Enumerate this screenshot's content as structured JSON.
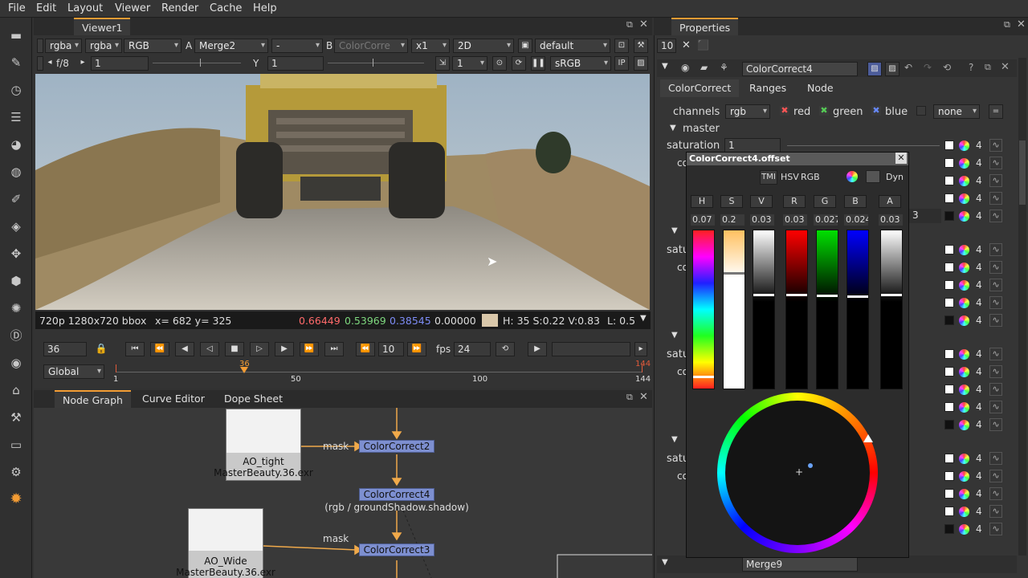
{
  "menubar": {
    "items": [
      "File",
      "Edit",
      "Layout",
      "Viewer",
      "Render",
      "Cache",
      "Help"
    ]
  },
  "viewer": {
    "tab": "Viewer1",
    "toolbar1": {
      "channels": "rgba",
      "alpha": "rgba",
      "display": "RGB",
      "a_label": "A",
      "a_input": "Merge2",
      "op": "-",
      "b_label": "B",
      "b_input": "ColorCorre",
      "zoom": "x1",
      "view": "2D",
      "lut": "default"
    },
    "toolbar2": {
      "fstop": "f/8",
      "gain": "1",
      "y_label": "Y",
      "gamma": "1",
      "proxy": "1",
      "colorspace": "sRGB",
      "ip": "IP"
    },
    "info": {
      "format": "720p 1280x720 bbox",
      "coords": "x= 682 y= 325",
      "r": "0.66449",
      "g": "0.53969",
      "b": "0.38545",
      "a": "0.00000",
      "swatch_color": "#d9c7aa",
      "hsv": "H: 35 S:0.22 V:0.83",
      "lum": "L: 0.5"
    },
    "timeline": {
      "frame": "36",
      "increment": "10",
      "fps_label": "fps",
      "fps": "24",
      "range_mode": "Global",
      "start": "1",
      "mid1": "50",
      "mid2": "100",
      "end": "144",
      "current": "36"
    }
  },
  "nodegraph": {
    "tabs": [
      "Node Graph",
      "Curve Editor",
      "Dope Sheet"
    ],
    "nodes": {
      "cc2": "ColorCorrect2",
      "cc4": "ColorCorrect4",
      "cc4_sub": "(rgb / groundShadow.shadow)",
      "cc3": "ColorCorrect3",
      "ao_tight": "AO_tight",
      "ao_tight_file": "MasterBeauty.36.exr",
      "ao_wide": "AO_Wide",
      "ao_wide_file": "MasterBeauty.36.exr",
      "mask1": "mask",
      "mask2": "mask"
    }
  },
  "properties": {
    "title": "Properties",
    "max_panels": "10",
    "node_name": "ColorCorrect4",
    "tabs": [
      "ColorCorrect",
      "Ranges",
      "Node"
    ],
    "channels_label": "channels",
    "channels_value": "rgb",
    "red": "red",
    "green": "green",
    "blue": "blue",
    "none": "none",
    "master": "master",
    "saturation_label": "saturation",
    "saturation_value": "1",
    "partial_labels": [
      "co",
      "satu",
      "co",
      "satu",
      "co",
      "satu",
      "co"
    ],
    "obscured_value": "3",
    "row_num": "4",
    "bottom_node": "Merge9"
  },
  "popup": {
    "title": "ColorCorrect4.offset",
    "mode_tmi": "TMI",
    "mode_hsv": "HSV",
    "mode_rgb": "RGB",
    "mode_dyn": "Dyn",
    "channels": [
      {
        "btn": "H",
        "value": "0.07"
      },
      {
        "btn": "S",
        "value": "0.2"
      },
      {
        "btn": "V",
        "value": "0.03"
      },
      {
        "btn": "R",
        "value": "0.03"
      },
      {
        "btn": "G",
        "value": "0.027"
      },
      {
        "btn": "B",
        "value": "0.024"
      },
      {
        "btn": "A",
        "value": "0.03"
      }
    ]
  }
}
